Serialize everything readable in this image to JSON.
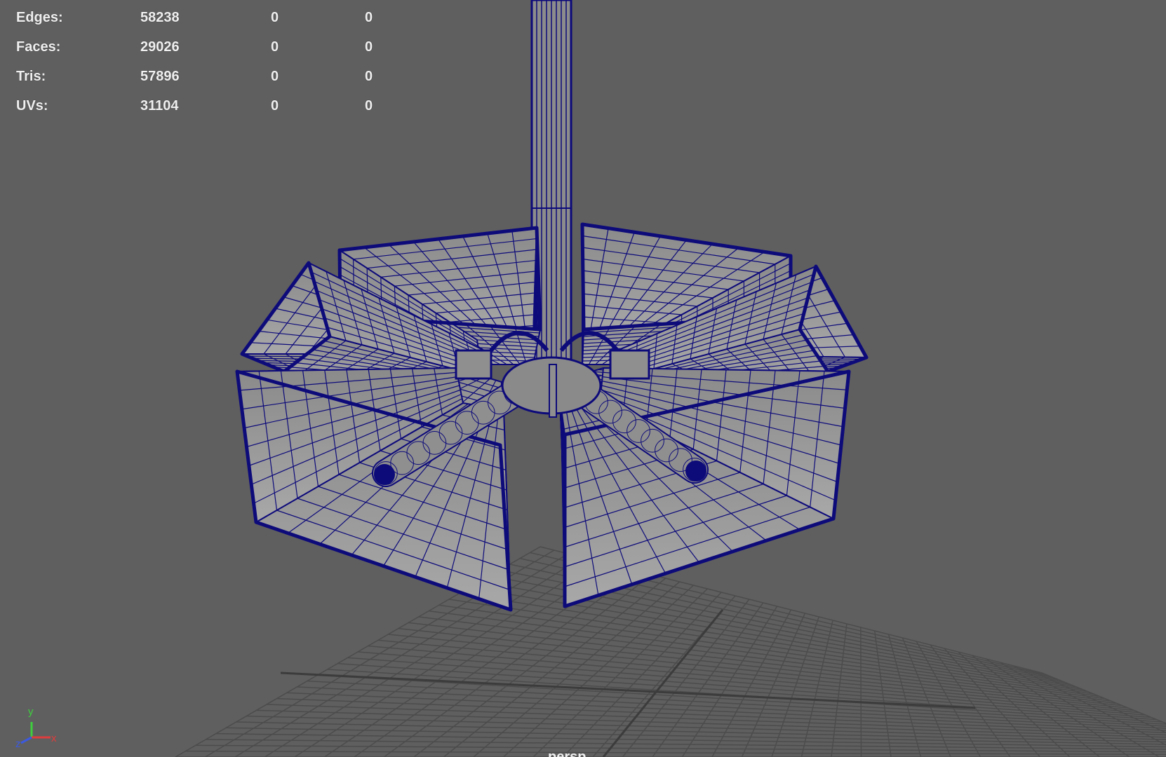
{
  "viewport": {
    "camera_name": "persp",
    "wire_color": "#0d0a7a",
    "background_color": "#5f5f5f"
  },
  "heads_up_display": {
    "rows": [
      {
        "label": "Edges:",
        "total": "58238",
        "selected": "0",
        "component": "0"
      },
      {
        "label": "Faces:",
        "total": "29026",
        "selected": "0",
        "component": "0"
      },
      {
        "label": "Tris:",
        "total": "57896",
        "selected": "0",
        "component": "0"
      },
      {
        "label": "UVs:",
        "total": "31104",
        "selected": "0",
        "component": "0"
      }
    ]
  },
  "axis_indicator": {
    "x": "x",
    "y": "y",
    "z": "z"
  }
}
